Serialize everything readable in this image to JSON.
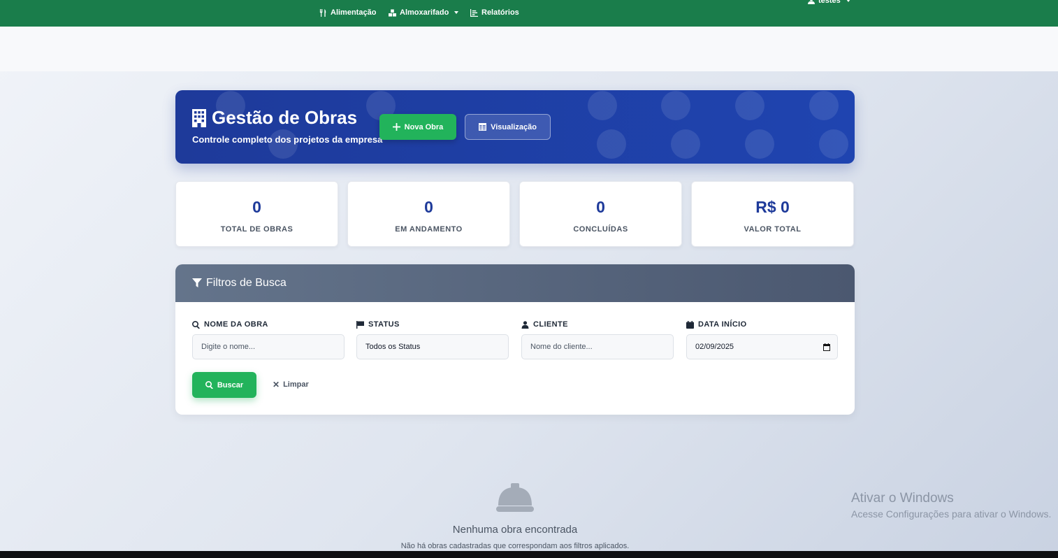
{
  "nav": {
    "items": [
      {
        "label": "Alimentação",
        "icon": "utensils-icon"
      },
      {
        "label": "Almoxarifado",
        "icon": "boxes-icon"
      },
      {
        "label": "Relatórios",
        "icon": "chart-icon"
      }
    ],
    "user": "testes"
  },
  "hero": {
    "title": "Gestão de Obras",
    "subtitle": "Controle completo dos projetos da empresa",
    "new_button": "Nova Obra",
    "view_button": "Visualização"
  },
  "stats": [
    {
      "value": "0",
      "label": "TOTAL DE OBRAS"
    },
    {
      "value": "0",
      "label": "EM ANDAMENTO"
    },
    {
      "value": "0",
      "label": "CONCLUÍDAS"
    },
    {
      "value": "R$ 0",
      "label": "VALOR TOTAL"
    }
  ],
  "filters": {
    "title": "Filtros de Busca",
    "fields": [
      {
        "label": "NOME DA OBRA",
        "placeholder": "Digite o nome...",
        "icon": "search-icon"
      },
      {
        "label": "STATUS",
        "value": "Todos os Status",
        "icon": "flag-icon"
      },
      {
        "label": "CLIENTE",
        "placeholder": "Nome do cliente...",
        "icon": "user-tie-icon"
      },
      {
        "label": "DATA INÍCIO",
        "value": "02/09/2025",
        "icon": "calendar-icon"
      }
    ],
    "search_button": "Buscar",
    "clear_button": "Limpar"
  },
  "empty": {
    "title": "Nenhuma obra encontrada",
    "subtitle": "Não há obras cadastradas que correspondam aos filtros aplicados."
  },
  "watermark": {
    "title": "Ativar o Windows",
    "subtitle": "Acesse Configurações para ativar o Windows."
  },
  "colors": {
    "nav": "#1a7d4b",
    "hero": "#1e3a9a",
    "accent_green": "#22b35b",
    "stat_value": "#1e3a9a",
    "filter_header": "#5b6880"
  }
}
